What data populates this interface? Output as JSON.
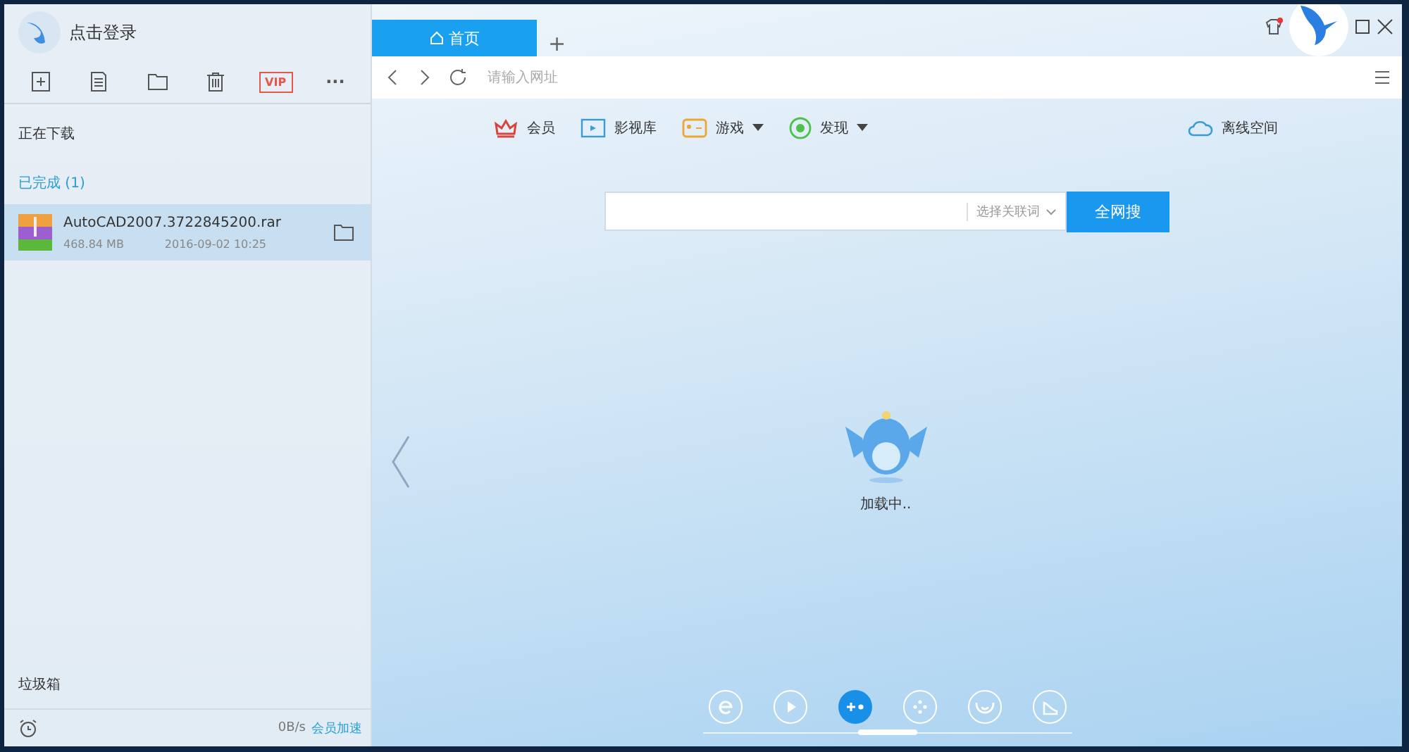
{
  "sidebar": {
    "login": "点击登录",
    "toolbar": [
      {
        "kind": "new"
      },
      {
        "kind": "doc"
      },
      {
        "kind": "folder"
      },
      {
        "kind": "trash"
      },
      {
        "kind": "vip",
        "label": "VIP"
      },
      {
        "kind": "more",
        "label": "···"
      }
    ],
    "downloading": "正在下载",
    "completed": "已完成 (1)",
    "files": [
      {
        "name": "AutoCAD2007.3722845200.rar",
        "size": "468.84 MB",
        "date": "2016-09-02 10:25",
        "selected": true
      }
    ],
    "trash": "垃圾箱",
    "speed": "0B/s",
    "boost": "会员加速"
  },
  "tabs": [
    {
      "label": "首页",
      "selected": true
    }
  ],
  "new_tab": "+",
  "address": {
    "placeholder": "请输入网址"
  },
  "nav": [
    {
      "kind": "crown",
      "label": "会员",
      "dropdown": false
    },
    {
      "kind": "video",
      "label": "影视库",
      "dropdown": false
    },
    {
      "kind": "game",
      "label": "游戏",
      "dropdown": true
    },
    {
      "kind": "discover",
      "label": "发现",
      "dropdown": true
    }
  ],
  "offline": "离线空间",
  "search": {
    "selector": "选择关联词",
    "button": "全网搜"
  },
  "loading": "加载中..",
  "dock": [
    {
      "kind": "browser",
      "selected": false
    },
    {
      "kind": "play",
      "selected": false
    },
    {
      "kind": "add",
      "selected": true
    },
    {
      "kind": "game",
      "selected": false
    },
    {
      "kind": "face",
      "selected": false
    },
    {
      "kind": "shoe",
      "selected": false
    }
  ]
}
